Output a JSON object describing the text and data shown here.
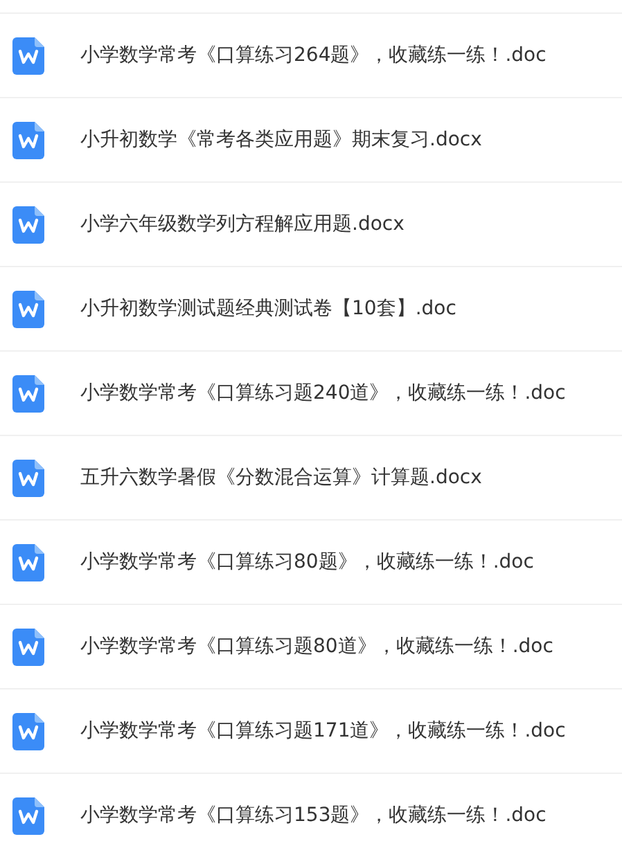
{
  "files": [
    {
      "name": "小学数学常考《口算练习264题》，收藏练一练！.doc"
    },
    {
      "name": "小升初数学《常考各类应用题》期末复习.docx"
    },
    {
      "name": "小学六年级数学列方程解应用题.docx"
    },
    {
      "name": "小升初数学测试题经典测试卷【10套】.doc"
    },
    {
      "name": "小学数学常考《口算练习题240道》，收藏练一练！.doc"
    },
    {
      "name": "五升六数学暑假《分数混合运算》计算题.docx"
    },
    {
      "name": "小学数学常考《口算练习80题》，收藏练一练！.doc"
    },
    {
      "name": "小学数学常考《口算练习题80道》，收藏练一练！.doc"
    },
    {
      "name": "小学数学常考《口算练习题171道》，收藏练一练！.doc"
    },
    {
      "name": "小学数学常考《口算练习153题》，收藏练一练！.doc"
    }
  ]
}
